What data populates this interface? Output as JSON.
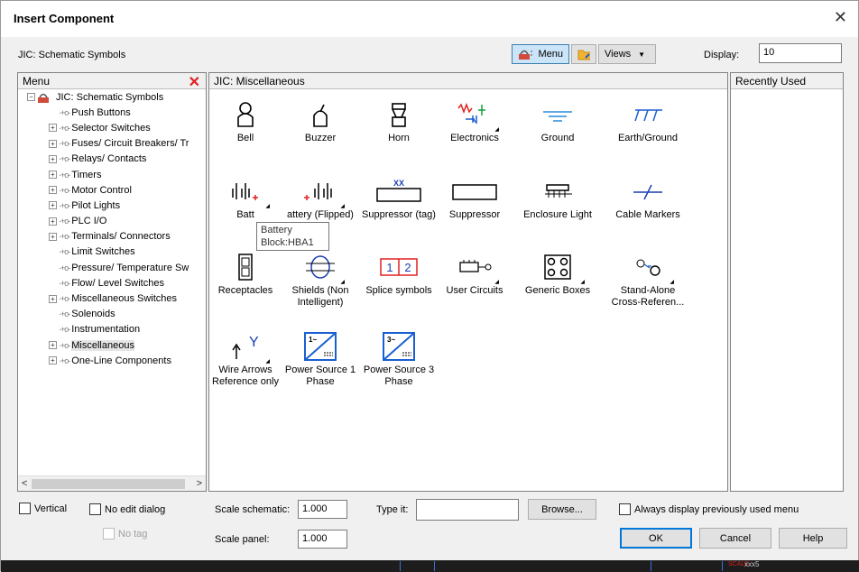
{
  "window": {
    "title": "Insert Component",
    "close": "✕"
  },
  "header": {
    "library": "JIC: Schematic Symbols",
    "menu_btn": "Menu",
    "views_btn": "Views",
    "display_label": "Display:",
    "display_value": "10"
  },
  "menu_panel": {
    "title": "Menu",
    "tree": [
      {
        "label": "JIC: Schematic Symbols",
        "root": true,
        "expand": "−"
      },
      {
        "label": "Push Buttons",
        "expand": ""
      },
      {
        "label": "Selector Switches",
        "expand": "+"
      },
      {
        "label": "Fuses/ Circuit Breakers/ Tr",
        "expand": "+"
      },
      {
        "label": "Relays/ Contacts",
        "expand": "+"
      },
      {
        "label": "Timers",
        "expand": "+"
      },
      {
        "label": "Motor Control",
        "expand": "+"
      },
      {
        "label": "Pilot Lights",
        "expand": "+"
      },
      {
        "label": "PLC I/O",
        "expand": "+"
      },
      {
        "label": "Terminals/ Connectors",
        "expand": "+"
      },
      {
        "label": "Limit Switches",
        "expand": ""
      },
      {
        "label": "Pressure/ Temperature Sw",
        "expand": ""
      },
      {
        "label": "Flow/ Level Switches",
        "expand": ""
      },
      {
        "label": "Miscellaneous Switches",
        "expand": "+"
      },
      {
        "label": "Solenoids",
        "expand": ""
      },
      {
        "label": "Instrumentation",
        "expand": ""
      },
      {
        "label": "Miscellaneous",
        "expand": "+",
        "selected": true
      },
      {
        "label": "One-Line Components",
        "expand": "+"
      }
    ]
  },
  "grid_panel": {
    "title": "JIC: Miscellaneous",
    "items": [
      {
        "label": "Bell",
        "icon": "bell-icon"
      },
      {
        "label": "Buzzer",
        "icon": "buzzer-icon"
      },
      {
        "label": "Horn",
        "icon": "horn-icon"
      },
      {
        "label": "Electronics",
        "icon": "electronics-icon"
      },
      {
        "label": "Ground",
        "icon": "ground-icon"
      },
      {
        "label": "Earth/Ground",
        "icon": "earth-ground-icon"
      },
      {
        "label": "Batt",
        "icon": "battery-icon"
      },
      {
        "label": "attery (Flipped)",
        "icon": "battery-flipped-icon"
      },
      {
        "label": "Suppressor (tag)",
        "icon": "suppressor-tag-icon"
      },
      {
        "label": "Suppressor",
        "icon": "suppressor-icon"
      },
      {
        "label": "Enclosure Light",
        "icon": "enclosure-light-icon"
      },
      {
        "label": "Cable Markers",
        "icon": "cable-markers-icon"
      },
      {
        "label": "Receptacles",
        "icon": "receptacle-icon"
      },
      {
        "label": "Shields (Non Intelligent)",
        "icon": "shield-icon"
      },
      {
        "label": "Splice symbols",
        "icon": "splice-icon"
      },
      {
        "label": "User Circuits",
        "icon": "user-circuits-icon"
      },
      {
        "label": "Generic Boxes",
        "icon": "generic-box-icon"
      },
      {
        "label": "Stand-Alone Cross-Referen...",
        "icon": "cross-reference-icon"
      },
      {
        "label": "Wire Arrows Reference only",
        "icon": "wire-arrow-icon"
      },
      {
        "label": "Power Source 1 Phase",
        "icon": "power-source-1-icon"
      },
      {
        "label": "Power Source 3 Phase",
        "icon": "power-source-3-icon"
      }
    ],
    "suppressor_tag_text": "XX",
    "splice_text": [
      "1",
      "2"
    ],
    "tooltip": {
      "line1": "Battery",
      "line2": "Block:HBA1"
    }
  },
  "recent_panel": {
    "title": "Recently Used"
  },
  "footer": {
    "vertical": "Vertical",
    "no_edit": "No edit dialog",
    "no_tag": "No tag",
    "scale_schematic_label": "Scale schematic:",
    "scale_schematic_value": "1.000",
    "scale_panel_label": "Scale panel:",
    "scale_panel_value": "1.000",
    "type_it_label": "Type it:",
    "type_it_value": "",
    "browse": "Browse...",
    "always_display": "Always display previously used menu",
    "ok": "OK",
    "cancel": "Cancel",
    "help": "Help"
  },
  "taskbar": {
    "scale": "SCALE",
    "xxx": "xxx5"
  },
  "colors": {
    "accent": "#0078d7",
    "icon_blue": "#1a5fd1",
    "close_red": "#e02020"
  }
}
